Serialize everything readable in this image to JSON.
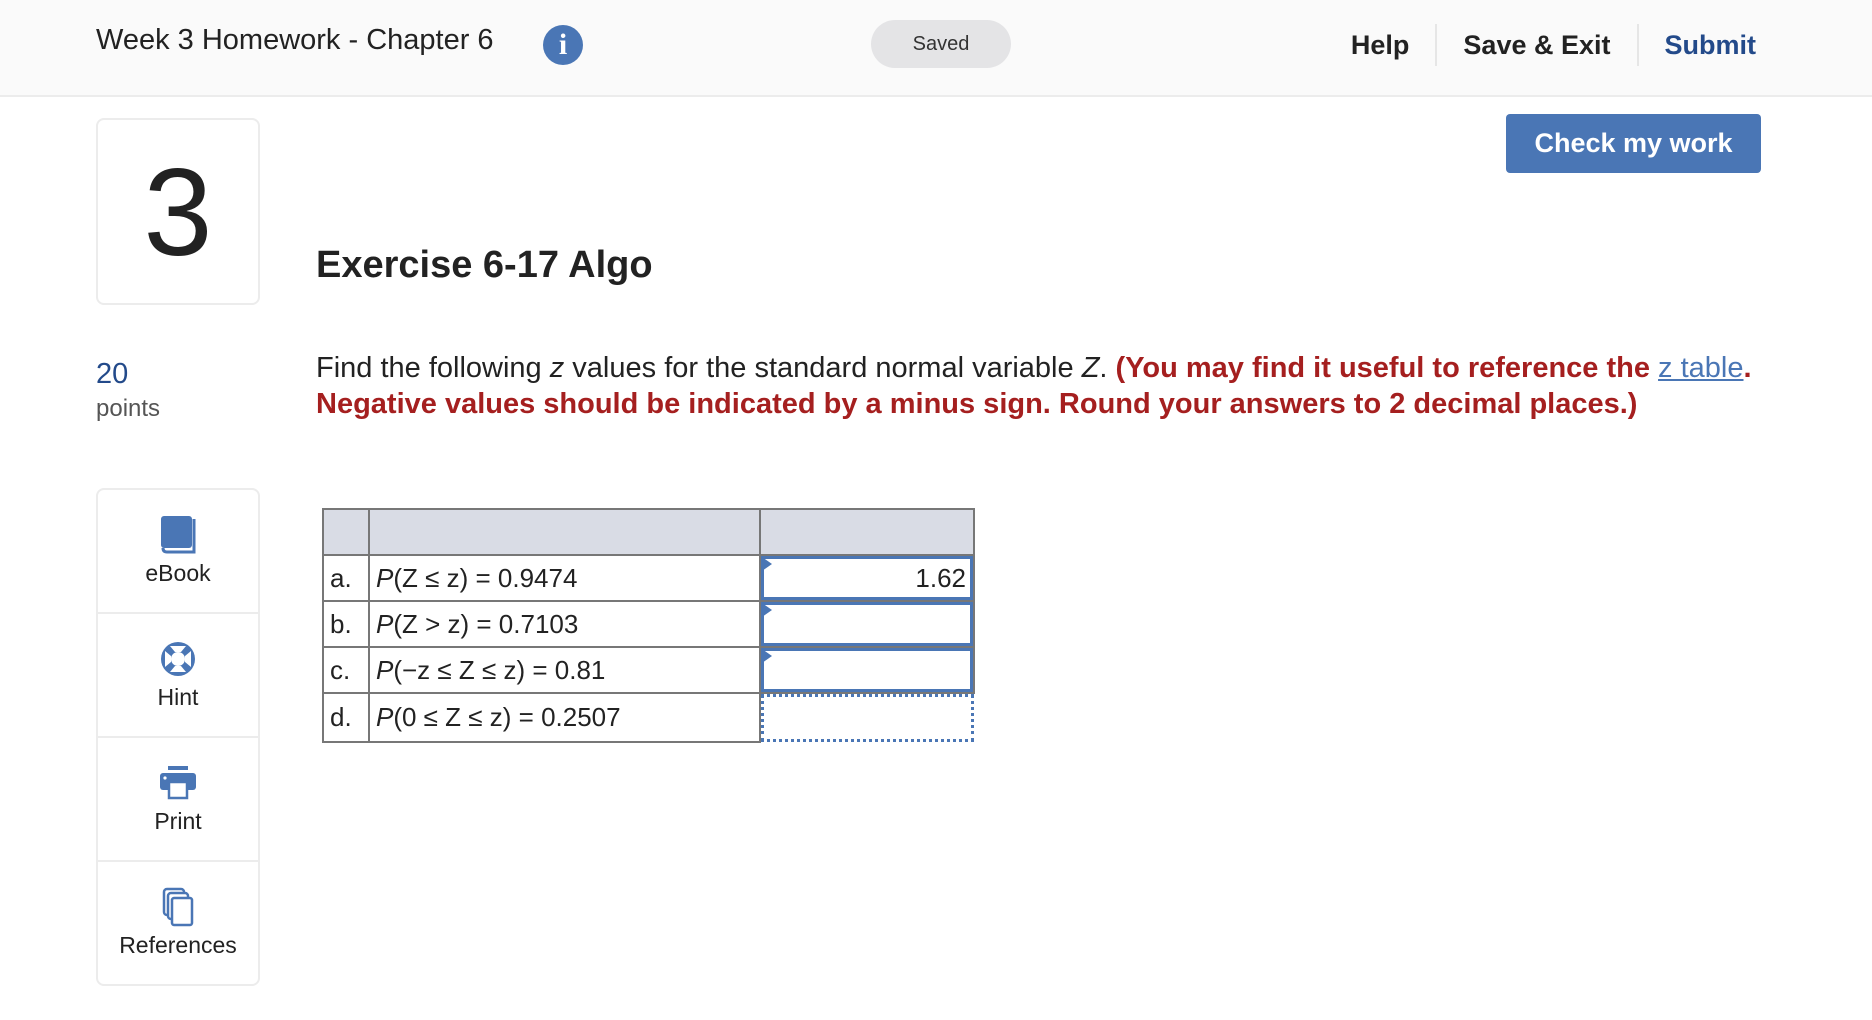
{
  "header": {
    "assignment_title": "Week 3 Homework - Chapter 6",
    "info_icon": "info-icon",
    "save_status": "Saved",
    "nav": {
      "help": "Help",
      "save_exit": "Save & Exit",
      "submit": "Submit"
    }
  },
  "check_button": "Check my work",
  "question": {
    "number": "3",
    "points_value": "20",
    "points_label": "points",
    "title": "Exercise 6-17 Algo",
    "text_before_z": "Find the following ",
    "z_var": "z",
    "text_after_z": " values for the standard normal variable ",
    "Z_var": "Z",
    "text_period": ". ",
    "instruction_part1": "(You may find it useful to reference the ",
    "link_text": "z table",
    "instruction_part2": ". Negative values should be indicated by a minus sign. Round your answers to 2 decimal places.)"
  },
  "tools": [
    {
      "label": "eBook",
      "icon": "book-icon"
    },
    {
      "label": "Hint",
      "icon": "lifebuoy-icon"
    },
    {
      "label": "Print",
      "icon": "printer-icon"
    },
    {
      "label": "References",
      "icon": "copy-pages-icon"
    }
  ],
  "table": {
    "rows": [
      {
        "letter": "a.",
        "prob_prefix": "P",
        "prob_body": "(Z ≤ z) = 0.9474",
        "answer": "1.62",
        "state": "filled"
      },
      {
        "letter": "b.",
        "prob_prefix": "P",
        "prob_body": "(Z > z) = 0.7103",
        "answer": "",
        "state": "empty"
      },
      {
        "letter": "c.",
        "prob_prefix": "P",
        "prob_body": "(−z ≤ Z ≤ z) = 0.81",
        "answer": "",
        "state": "empty"
      },
      {
        "letter": "d.",
        "prob_prefix": "P",
        "prob_body": "(0 ≤ Z ≤ z) = 0.2507",
        "answer": "",
        "state": "focused-dotted"
      }
    ]
  },
  "colors": {
    "accent": "#4a76b5",
    "submit": "#234a8a",
    "instruction_red": "#a51f1f",
    "table_header": "#d9dce5"
  }
}
